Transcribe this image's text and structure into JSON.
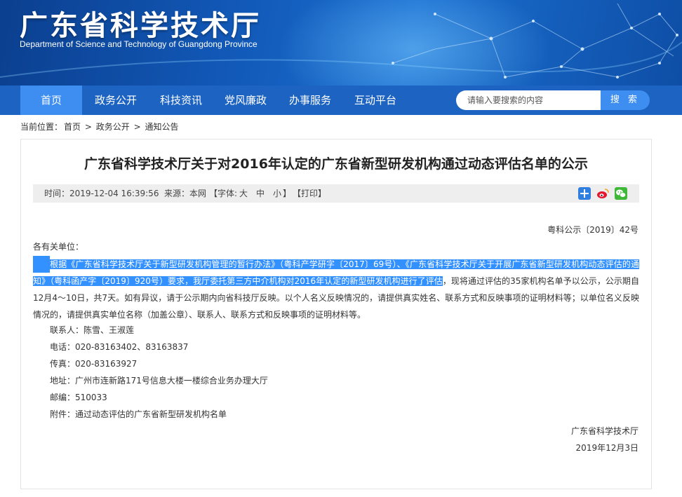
{
  "header": {
    "title": "广东省科学技术厅",
    "subtitle": "Department of Science and Technology of Guangdong Province"
  },
  "nav": {
    "items": [
      "首页",
      "政务公开",
      "科技资讯",
      "党风廉政",
      "办事服务",
      "互动平台"
    ],
    "active_index": 0,
    "search_placeholder": "请输入要搜索的内容",
    "search_button": "搜 索"
  },
  "breadcrumb": {
    "prefix": "当前位置：",
    "items": [
      "首页",
      "政务公开",
      "通知公告"
    ],
    "sep": ">"
  },
  "article": {
    "title": "广东省科学技术厅关于对2016年认定的广东省新型研发机构通过动态评估名单的公示",
    "time": "时间：2019-12-04 16:39:56",
    "source": "来源：本网",
    "font_label": "【字体:",
    "font_large": "大",
    "font_medium": "中",
    "font_small": "小",
    "font_close": "】",
    "print": "【打印】",
    "doc_number": "粤科公示〔2019〕42号",
    "greeting": "各有关单位：",
    "para_highlight_1": "根据《广东省科学技术厅关于新型研发机构管理的暂行办法》（粤科产学研字〔2017〕69号）、《广东省科学技术厅关于开展广东省新型研发机构动态评估的",
    "para_highlight_2": "通知》（粤科函产字〔2019〕920号）要求，我厅委托第三方中介机构对2016年认定的新型研发机构进行了评估",
    "para_rest": "，现将通过评估的35家机构名单予以公示，公示期自12月4～10日，共7天。如有异议，请于公示期内向省科技厅反映。以个人名义反映情况的，请提供真实姓名、联系方式和反映事项的证明材料等；以单位名义反映情况的，请提供真实单位名称（加盖公章）、联系人、联系方式和反映事项的证明材料等。",
    "contact": "联系人：陈雪、王淑莲",
    "phone": "电话：020-83163402、83163837",
    "fax": "传真：020-83163927",
    "address": "地址：广州市连新路171号信息大楼一楼综合业务办理大厅",
    "postcode": "邮编：510033",
    "attachment_label": "附件：",
    "attachment_link": "通过动态评估的广东省新型研发机构名单",
    "signer": "广东省科学技术厅",
    "date": "2019年12月3日"
  },
  "share_icons": [
    "plus-share-icon",
    "weibo-icon",
    "wechat-icon"
  ],
  "colors": {
    "nav_bg": "#1d63c2",
    "nav_active": "#3d8ef0",
    "highlight": "#3390ff",
    "meta_bg": "#eeeeee"
  }
}
